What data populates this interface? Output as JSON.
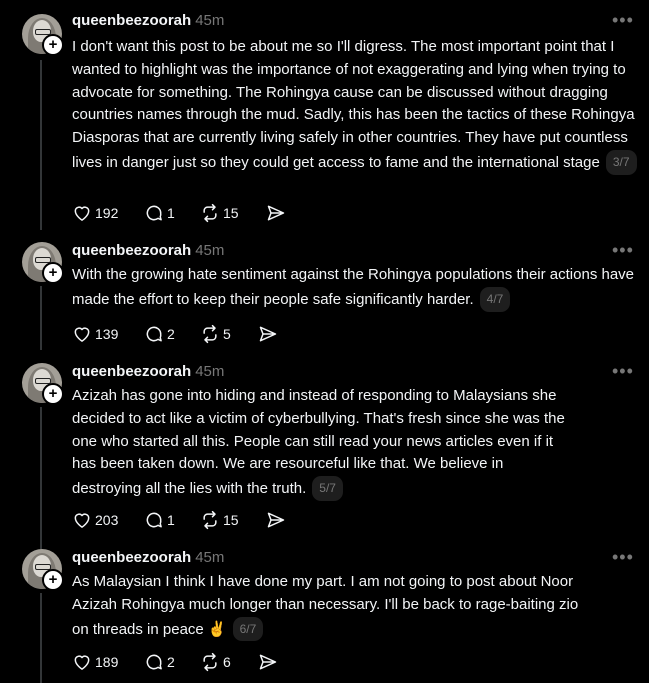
{
  "posts": [
    {
      "username": "queenbeezoorah",
      "time": "45m",
      "text": "I don't want this post to be about me so I'll digress. The most important point that I wanted to highlight was the importance of not exaggerating and lying when trying to advocate for something. The Rohingya cause can be discussed without dragging countries names through the mud. Sadly, this has been the tactics of these Rohingya Diasporas that are currently living safely in other countries. They have put countless lives in danger just so they could get access to fame and the international stage",
      "page": "3/7",
      "likes": "192",
      "replies": "1",
      "reposts": "15"
    },
    {
      "username": "queenbeezoorah",
      "time": "45m",
      "text": "With the growing hate sentiment against the Rohingya populations their actions have made the effort to keep their people safe significantly harder.",
      "page": "4/7",
      "likes": "139",
      "replies": "2",
      "reposts": "5"
    },
    {
      "username": "queenbeezoorah",
      "time": "45m",
      "text": "Azizah has gone into hiding and instead of responding to Malaysians she decided to act like a victim of cyberbullying. That's fresh since she was the one who started all this. People can still read your news articles even if it has been taken down. We are resourceful like that. We believe in destroying all the lies with the truth.",
      "page": "5/7",
      "likes": "203",
      "replies": "1",
      "reposts": "15"
    },
    {
      "username": "queenbeezoorah",
      "time": "45m",
      "text": "As Malaysian I think I have done my part. I am not going to post about Noor Azizah Rohingya much longer than necessary. I'll be back to rage-baiting zio on threads in peace ✌️",
      "page": "6/7",
      "likes": "189",
      "replies": "2",
      "reposts": "6"
    }
  ],
  "icons": {
    "like": "heart-icon",
    "reply": "comment-icon",
    "repost": "repost-icon",
    "share": "send-icon",
    "more": "more-icon",
    "follow": "plus-icon"
  }
}
